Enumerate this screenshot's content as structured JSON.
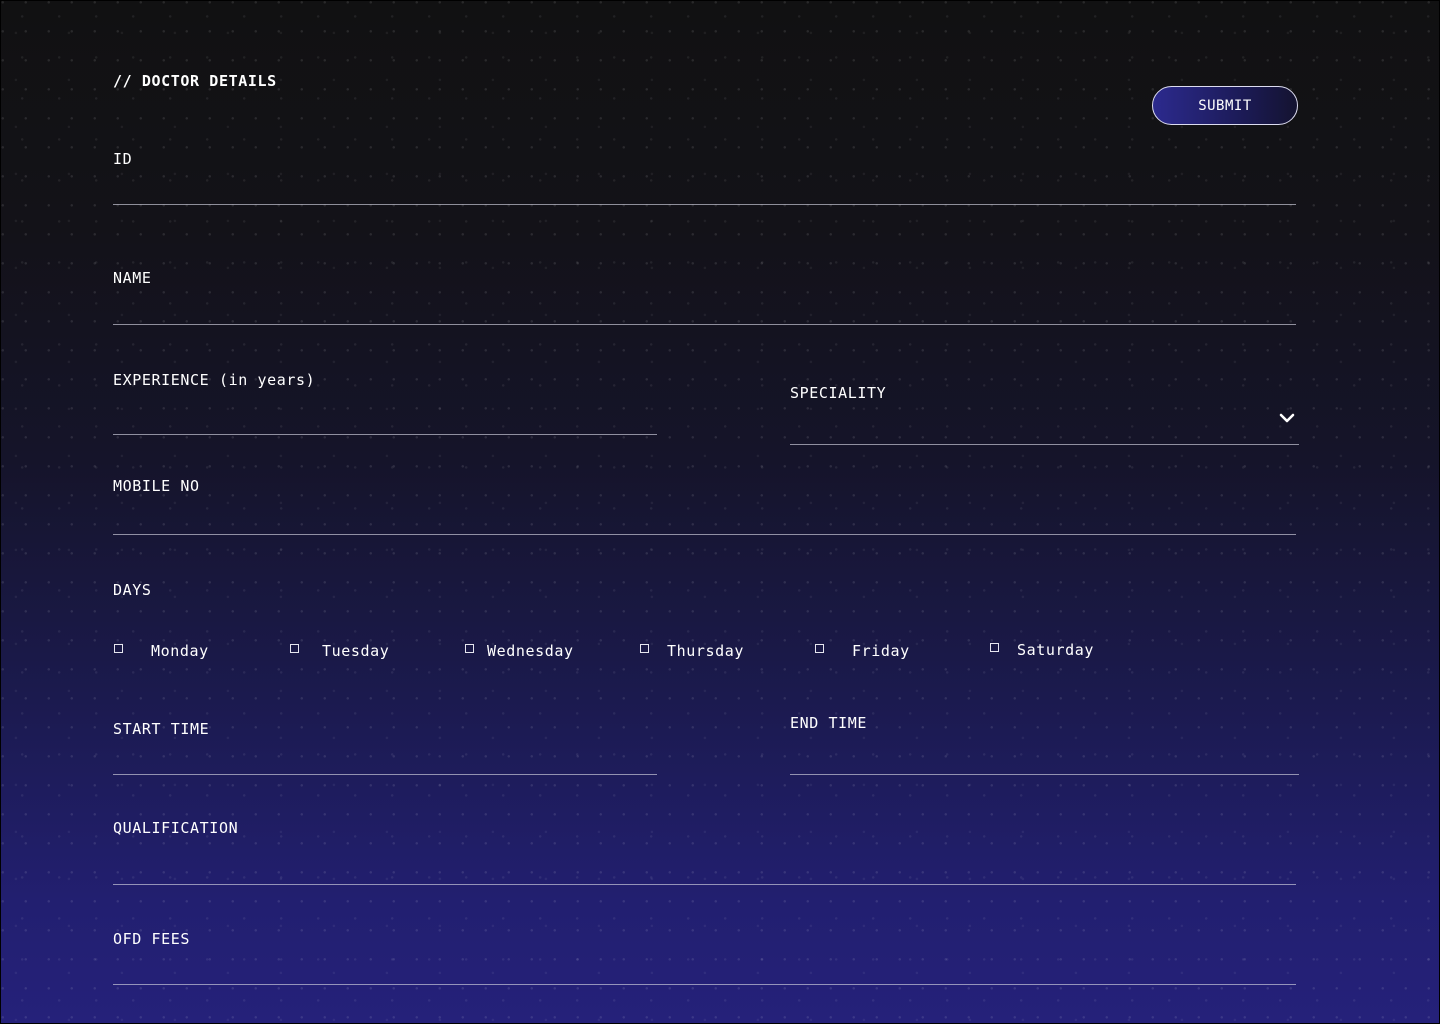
{
  "form": {
    "section_title": "// DOCTOR DETAILS",
    "submit_label": "SUBMIT",
    "fields": {
      "id": {
        "label": "ID",
        "value": ""
      },
      "name": {
        "label": "NAME",
        "value": ""
      },
      "experience": {
        "label": "EXPERIENCE (in years)",
        "value": ""
      },
      "speciality": {
        "label": "SPECIALITY",
        "value": "",
        "icon": "chevron-down-icon"
      },
      "mobile": {
        "label": "MOBILE NO",
        "value": ""
      },
      "start_time": {
        "label": "START TIME",
        "value": ""
      },
      "end_time": {
        "label": "END TIME",
        "value": ""
      },
      "qualification": {
        "label": "QUALIFICATION",
        "value": ""
      },
      "fees": {
        "label": "OFD FEES",
        "value": ""
      }
    },
    "days": {
      "label": "DAYS",
      "options": [
        {
          "label": "Monday",
          "checked": false
        },
        {
          "label": "Tuesday",
          "checked": false
        },
        {
          "label": "Wednesday",
          "checked": false
        },
        {
          "label": "Thursday",
          "checked": false
        },
        {
          "label": "Friday",
          "checked": false
        },
        {
          "label": "Saturday",
          "checked": false
        }
      ]
    }
  },
  "colors": {
    "background_top": "#111112",
    "background_bottom": "#25217a",
    "accent": "#2c2a8e",
    "text": "#ffffff"
  }
}
